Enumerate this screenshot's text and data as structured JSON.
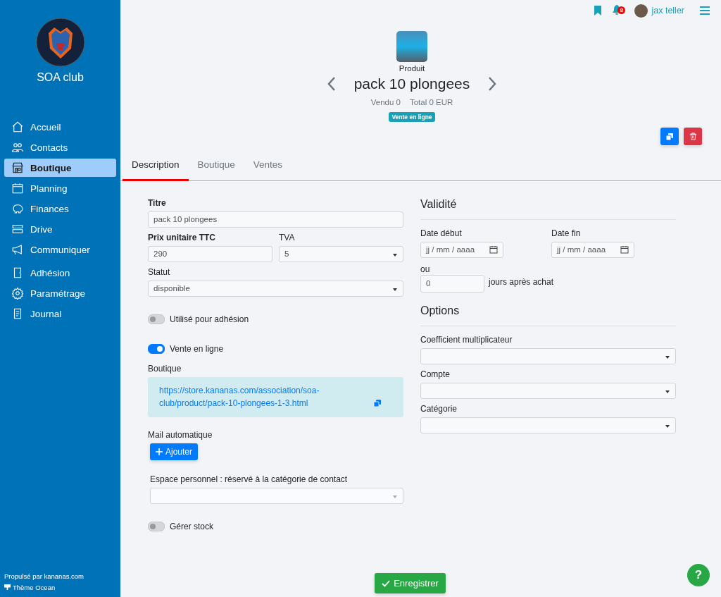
{
  "sidebar": {
    "club_name": "SOA club",
    "items": [
      {
        "label": "Accueil",
        "selected": false
      },
      {
        "label": "Contacts",
        "selected": false
      },
      {
        "label": "Boutique",
        "selected": true
      },
      {
        "label": "Planning",
        "selected": false
      },
      {
        "label": "Finances",
        "selected": false
      },
      {
        "label": "Drive",
        "selected": false
      },
      {
        "label": "Communiquer",
        "selected": false
      },
      {
        "label": "Adhésion",
        "selected": false
      },
      {
        "label": "Paramétrage",
        "selected": false
      },
      {
        "label": "Journal",
        "selected": false
      }
    ],
    "footer": {
      "powered_by": "Propulsé par kananas.com",
      "theme": "Thème Ocean"
    }
  },
  "topbar": {
    "notification_count": "8",
    "user_name": "jax teller"
  },
  "header": {
    "type_label": "Produit",
    "title": "pack 10 plongees",
    "sold": "Vendu 0",
    "total": "Total 0 EUR",
    "badge": "Vente en ligne"
  },
  "tabs": [
    {
      "label": "Description",
      "selected": true
    },
    {
      "label": "Boutique",
      "selected": false
    },
    {
      "label": "Ventes",
      "selected": false
    }
  ],
  "form": {
    "titre": {
      "label": "Titre",
      "value": "pack 10 plongees"
    },
    "prix": {
      "label": "Prix unitaire TTC",
      "value": "290"
    },
    "tva": {
      "label": "TVA",
      "value": "5"
    },
    "statut": {
      "label": "Statut",
      "value": "disponible"
    },
    "toggle_adhesion": {
      "label": "Utilisé pour adhésion",
      "on": false
    },
    "toggle_online": {
      "label": "Vente en ligne",
      "on": true
    },
    "boutique": {
      "label": "Boutique",
      "url": "https://store.kananas.com/association/soa-club/product/pack-10-plongees-1-3.html"
    },
    "mail": {
      "label": "Mail automatique",
      "button": "Ajouter"
    },
    "espace": {
      "label": "Espace personnel : réservé à la catégorie de contact"
    },
    "toggle_stock": {
      "label": "Gérer stock",
      "on": false
    }
  },
  "validite": {
    "heading": "Validité",
    "date_debut": {
      "label": "Date début",
      "placeholder": "jj / mm / aaaa"
    },
    "date_fin": {
      "label": "Date fin",
      "placeholder": "jj / mm / aaaa"
    },
    "ou": "ou",
    "jours": {
      "value": "0",
      "suffix": "jours après achat"
    }
  },
  "options": {
    "heading": "Options",
    "fields": [
      {
        "label": "Coefficient multiplicateur"
      },
      {
        "label": "Compte"
      },
      {
        "label": "Catégorie"
      }
    ]
  },
  "save_button": "Enregistrer",
  "help_button": "?"
}
